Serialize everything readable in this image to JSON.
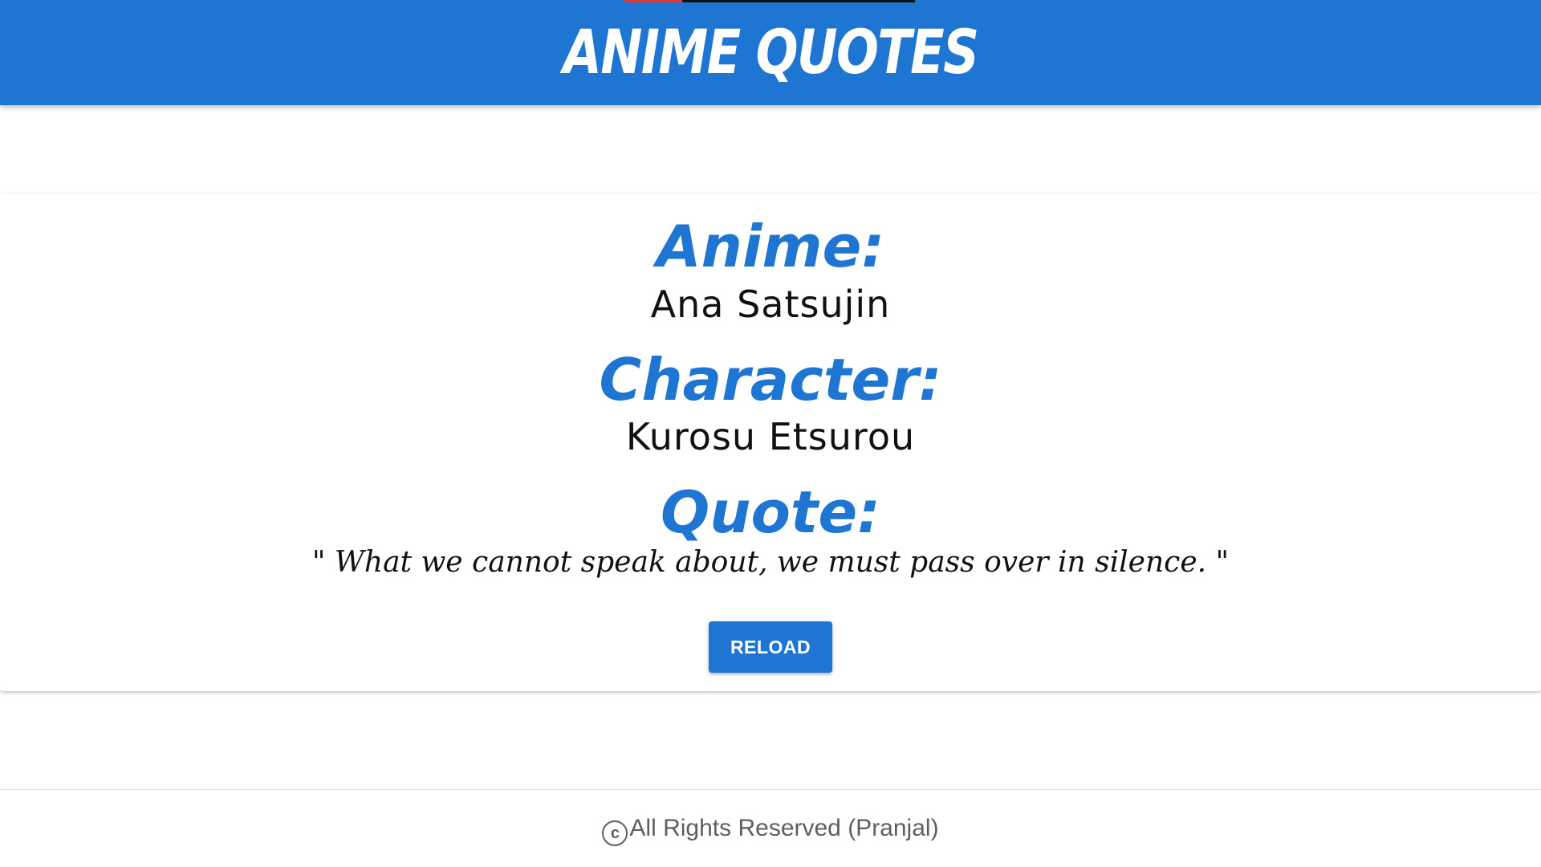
{
  "header": {
    "title": "ANIME QUOTES"
  },
  "card": {
    "anime_label": "Anime:",
    "anime_value": "Ana Satsujin",
    "character_label": "Character:",
    "character_value": "Kurosu Etsurou",
    "quote_label": "Quote:",
    "quote_value": "\" What we cannot speak about, we must pass over in silence. \"",
    "reload_label": "RELOAD"
  },
  "footer": {
    "icon": "copyright-icon",
    "text": "All Rights Reserved (Pranjal)"
  },
  "colors": {
    "accent": "#1e76d2",
    "text": "#111111",
    "footer_text": "#5f5f5f"
  }
}
